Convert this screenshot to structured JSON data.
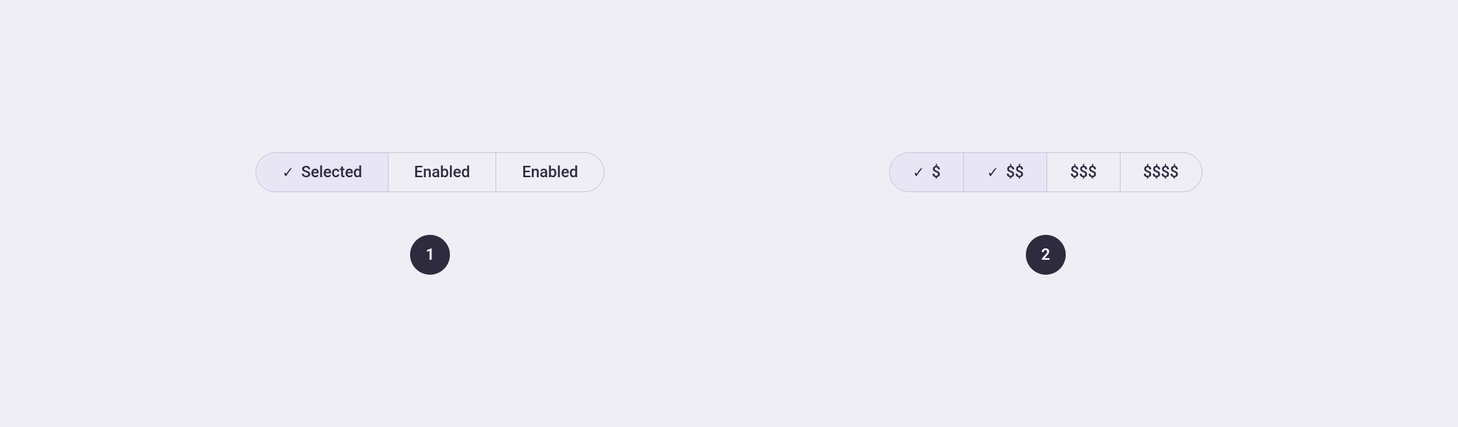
{
  "example1": {
    "segments": [
      {
        "id": "selected",
        "label": "Selected",
        "selected": true,
        "hasCheck": true
      },
      {
        "id": "enabled1",
        "label": "Enabled",
        "selected": false,
        "hasCheck": false
      },
      {
        "id": "enabled2",
        "label": "Enabled",
        "selected": false,
        "hasCheck": false
      }
    ],
    "badge": "1"
  },
  "example2": {
    "segments": [
      {
        "id": "price1",
        "label": "$",
        "selected": true,
        "hasCheck": true
      },
      {
        "id": "price2",
        "label": "$$",
        "selected": true,
        "hasCheck": true
      },
      {
        "id": "price3",
        "label": "$$$",
        "selected": false,
        "hasCheck": false
      },
      {
        "id": "price4",
        "label": "$$$$",
        "selected": false,
        "hasCheck": false
      }
    ],
    "badge": "2"
  }
}
